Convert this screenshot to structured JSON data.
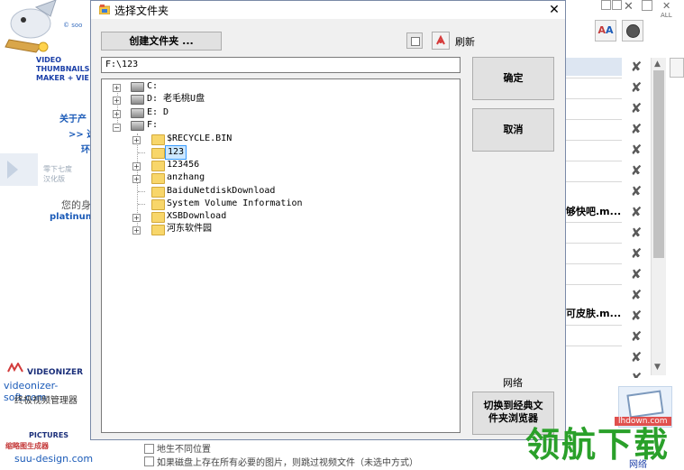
{
  "background_app": {
    "left": {
      "brand_lines": [
        "VIDEO",
        "THUMBNAILS",
        "MAKER + VIE"
      ],
      "brand_small": "© soo",
      "about": "关于产",
      "nav1": ">> 选",
      "nav2": "环",
      "widget_label1": "零下七度",
      "widget_label2": "汉化版",
      "your_text": "您的身",
      "platinum": "platinum",
      "videonizer_title": "VIDEONIZER",
      "videonizer_url": "videonizer-soft.com",
      "videonizer_desc": "终极视频管理器",
      "pictures_title": "PICTURES",
      "pictures_sub": "缩略图生成器",
      "pictures_url": "suu-design.com"
    },
    "right": {
      "top_label": "ALL",
      "fragment1": "够快吧.m...",
      "fragment2": "可皮肤.m...",
      "bottom_caption": "网络"
    },
    "bottom": {
      "line1": "地生不同位置",
      "line2": "如果磁盘上存在所有必要的图片，则跳过视频文件（未选中方式）"
    }
  },
  "dialog": {
    "title": "选择文件夹",
    "create_folder_label": "创建文件夹 ...",
    "refresh_label": "刷新",
    "path_value": "F:\\123",
    "ok_label": "确定",
    "cancel_label": "取消",
    "network_label": "网络",
    "switch_label_line1": "切换到经典文",
    "switch_label_line2": "件夹浏览器",
    "tree": {
      "drive_c": "C:",
      "drive_d": "D: 老毛桃U盘",
      "drive_e": "E: D",
      "drive_f": "F:",
      "f_children": [
        "$RECYCLE.BIN",
        "123",
        "123456",
        "anzhang",
        "BaiduNetdiskDownload",
        "System Volume Information",
        "XSBDownload",
        "河东软件园"
      ]
    }
  },
  "watermark": {
    "text": "领航下载",
    "url": "lhdown.com"
  }
}
